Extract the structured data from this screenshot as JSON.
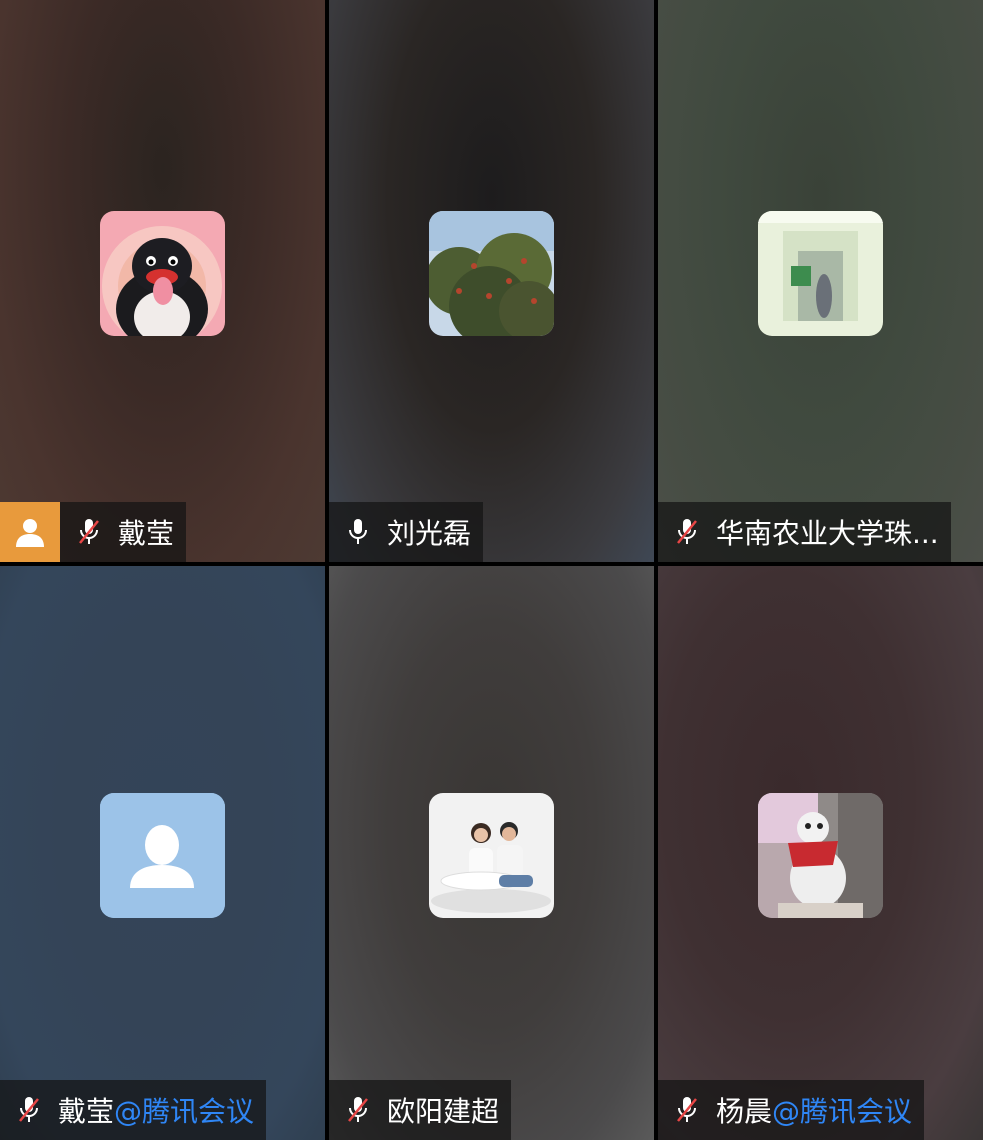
{
  "participants": [
    {
      "name": "戴莹",
      "suffix": "",
      "mic": "muted",
      "host": true,
      "avatar": "penguin-avatar"
    },
    {
      "name": "刘光磊",
      "suffix": "",
      "mic": "on",
      "host": false,
      "avatar": "tree-avatar"
    },
    {
      "name": "华南农业大学珠...",
      "suffix": "",
      "mic": "muted",
      "host": false,
      "avatar": "corridor-avatar"
    },
    {
      "name": "戴莹",
      "suffix": "@腾讯会议",
      "mic": "muted",
      "host": false,
      "avatar": "default-user-avatar"
    },
    {
      "name": "欧阳建超",
      "suffix": "",
      "mic": "muted",
      "host": false,
      "avatar": "couple-photo-avatar"
    },
    {
      "name": "杨晨",
      "suffix": "@腾讯会议",
      "mic": "muted",
      "host": false,
      "avatar": "dog-avatar"
    }
  ],
  "colors": {
    "host_badge": "#e89a3c",
    "app_suffix": "#2f86f5",
    "default_avatar_bg": "#9cc3e8"
  }
}
